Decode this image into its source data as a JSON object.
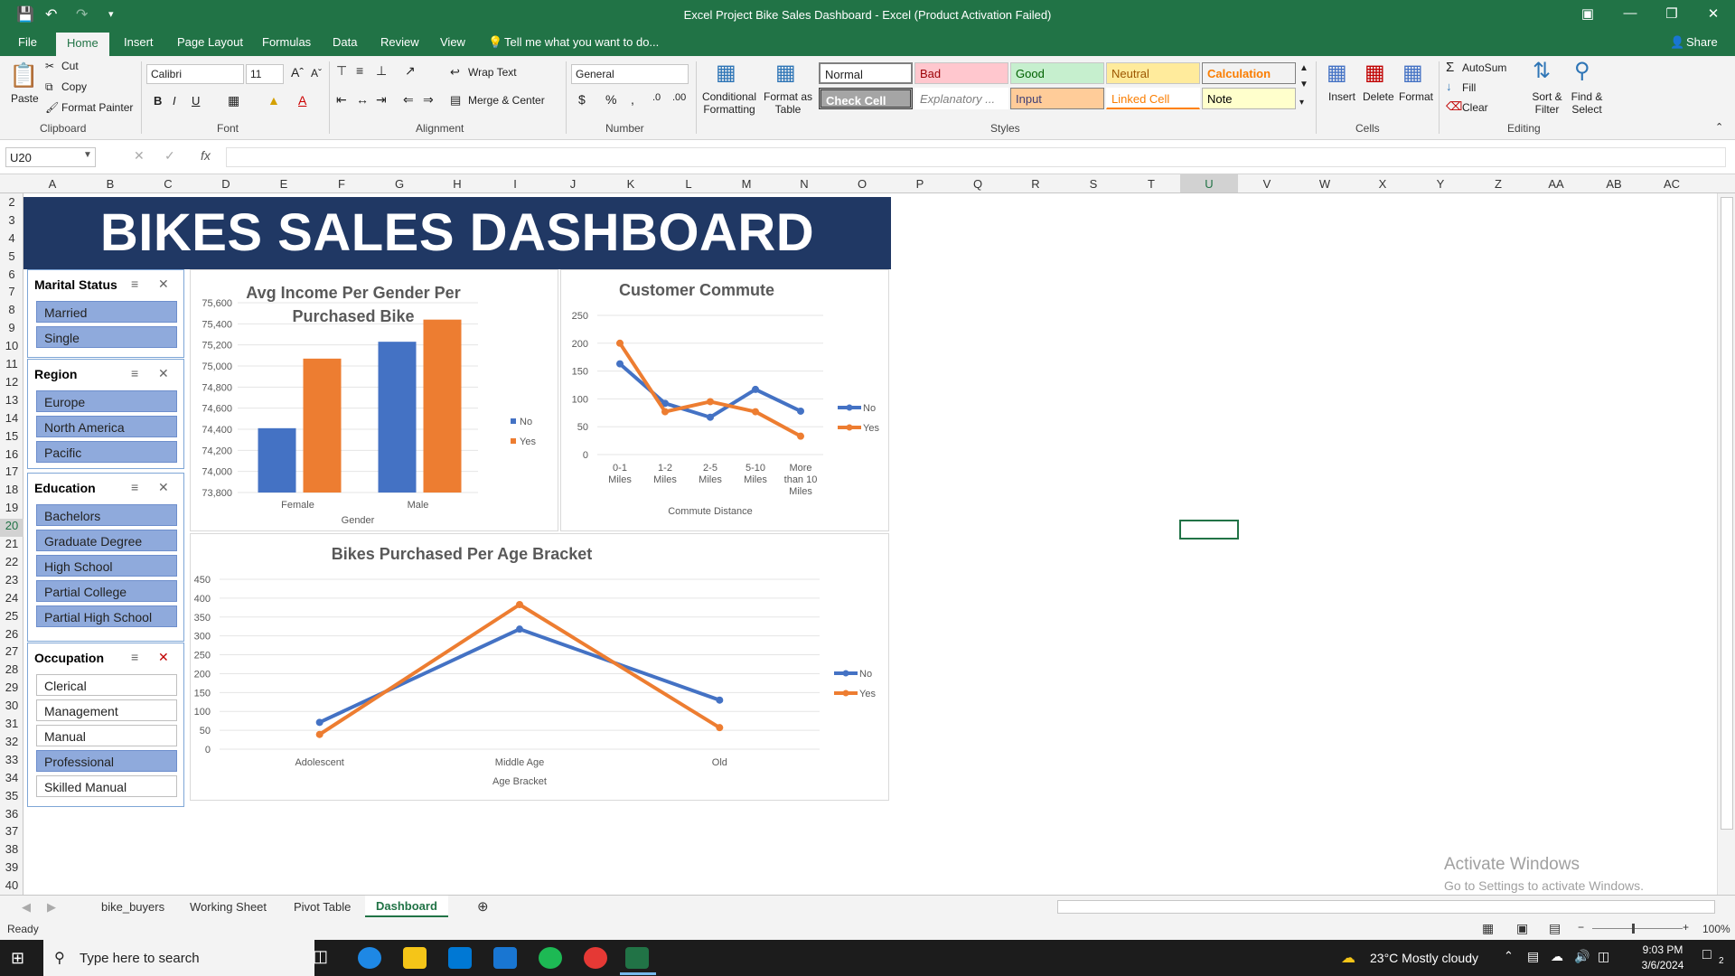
{
  "window": {
    "title": "Excel Project Bike Sales Dashboard - Excel (Product Activation Failed)",
    "share_label": "Share"
  },
  "tabs": [
    "File",
    "Home",
    "Insert",
    "Page Layout",
    "Formulas",
    "Data",
    "Review",
    "View"
  ],
  "tell_me": "Tell me what you want to do...",
  "ribbon": {
    "clipboard": {
      "paste": "Paste",
      "cut": "Cut",
      "copy": "Copy",
      "format_painter": "Format Painter",
      "label": "Clipboard"
    },
    "font": {
      "name": "Calibri",
      "size": "11",
      "label": "Font"
    },
    "alignment": {
      "wrap": "Wrap Text",
      "merge": "Merge & Center",
      "label": "Alignment"
    },
    "number": {
      "format": "General",
      "label": "Number"
    },
    "styles": {
      "conditional": "Conditional Formatting",
      "format_table": "Format as Table",
      "cells": [
        "Normal",
        "Bad",
        "Good",
        "Neutral",
        "Calculation",
        "Check Cell",
        "Explanatory ...",
        "Input",
        "Linked Cell",
        "Note"
      ],
      "label": "Styles"
    },
    "cells": {
      "insert": "Insert",
      "delete": "Delete",
      "format": "Format",
      "label": "Cells"
    },
    "editing": {
      "autosum": "AutoSum",
      "fill": "Fill",
      "clear": "Clear",
      "sort": "Sort & Filter",
      "find": "Find & Select",
      "label": "Editing"
    }
  },
  "name_box": "U20",
  "columns": [
    "A",
    "B",
    "C",
    "D",
    "E",
    "F",
    "G",
    "H",
    "I",
    "J",
    "K",
    "L",
    "M",
    "N",
    "O",
    "P",
    "Q",
    "R",
    "S",
    "T",
    "U",
    "V",
    "W",
    "X",
    "Y",
    "Z",
    "AA",
    "AB",
    "AC"
  ],
  "rows": [
    "2",
    "3",
    "4",
    "5",
    "6",
    "7",
    "8",
    "9",
    "10",
    "11",
    "12",
    "13",
    "14",
    "15",
    "16",
    "17",
    "18",
    "19",
    "20",
    "21",
    "22",
    "23",
    "24",
    "25",
    "26",
    "27",
    "28",
    "29",
    "30",
    "31",
    "32",
    "33",
    "34",
    "35",
    "36",
    "37",
    "38",
    "39",
    "40"
  ],
  "dashboard_title": "BIKES SALES DASHBOARD",
  "slicers": [
    {
      "title": "Marital Status",
      "items": [
        {
          "label": "Married",
          "selected": true
        },
        {
          "label": "Single",
          "selected": true
        }
      ]
    },
    {
      "title": "Region",
      "items": [
        {
          "label": "Europe",
          "selected": true
        },
        {
          "label": "North America",
          "selected": true
        },
        {
          "label": "Pacific",
          "selected": true
        }
      ]
    },
    {
      "title": "Education",
      "items": [
        {
          "label": "Bachelors",
          "selected": true
        },
        {
          "label": "Graduate Degree",
          "selected": true
        },
        {
          "label": "High School",
          "selected": true
        },
        {
          "label": "Partial College",
          "selected": true
        },
        {
          "label": "Partial High School",
          "selected": true
        }
      ]
    },
    {
      "title": "Occupation",
      "items": [
        {
          "label": "Clerical",
          "selected": false
        },
        {
          "label": "Management",
          "selected": false
        },
        {
          "label": "Manual",
          "selected": false
        },
        {
          "label": "Professional",
          "selected": true
        },
        {
          "label": "Skilled Manual",
          "selected": false
        }
      ]
    }
  ],
  "chart_data": [
    {
      "type": "bar",
      "title": "Avg Income Per Gender Per Purchased Bike",
      "xlabel": "Gender",
      "ylabel": "",
      "categories": [
        "Female",
        "Male"
      ],
      "series": [
        {
          "name": "No",
          "values": [
            74410,
            75230
          ],
          "color": "#4472c4"
        },
        {
          "name": "Yes",
          "values": [
            75070,
            75440
          ],
          "color": "#ed7d31"
        }
      ],
      "ylim": [
        73800,
        75600
      ],
      "yticks": [
        "75,600",
        "75,400",
        "75,200",
        "75,000",
        "74,800",
        "74,600",
        "74,400",
        "74,200",
        "74,000",
        "73,800"
      ],
      "legend": "right"
    },
    {
      "type": "line",
      "title": "Customer Commute",
      "xlabel": "Commute Distance",
      "ylabel": "",
      "categories": [
        "0-1 Miles",
        "1-2 Miles",
        "2-5 Miles",
        "5-10 Miles",
        "More than 10 Miles"
      ],
      "series": [
        {
          "name": "No",
          "values": [
            163,
            92,
            67,
            117,
            78
          ],
          "color": "#4472c4"
        },
        {
          "name": "Yes",
          "values": [
            200,
            77,
            95,
            77,
            33
          ],
          "color": "#ed7d31"
        }
      ],
      "ylim": [
        0,
        250
      ],
      "yticks": [
        "250",
        "200",
        "150",
        "100",
        "50",
        "0"
      ],
      "legend": "right"
    },
    {
      "type": "line",
      "title": "Bikes Purchased Per Age Bracket",
      "xlabel": "Age Bracket",
      "ylabel": "",
      "categories": [
        "Adolescent",
        "Middle Age",
        "Old"
      ],
      "series": [
        {
          "name": "No",
          "values": [
            71,
            318,
            130
          ],
          "color": "#4472c4"
        },
        {
          "name": "Yes",
          "values": [
            39,
            383,
            57
          ],
          "color": "#ed7d31"
        }
      ],
      "ylim": [
        0,
        450
      ],
      "yticks": [
        "450",
        "400",
        "350",
        "300",
        "250",
        "200",
        "150",
        "100",
        "50",
        "0"
      ],
      "legend": "right"
    }
  ],
  "sheets": [
    "bike_buyers",
    "Working Sheet",
    "Pivot Table",
    "Dashboard"
  ],
  "active_sheet": "Dashboard",
  "status": {
    "ready": "Ready",
    "zoom": "100%"
  },
  "watermark": {
    "line1": "Activate Windows",
    "line2": "Go to Settings to activate Windows."
  },
  "taskbar": {
    "search_placeholder": "Type here to search",
    "weather": "23°C  Mostly cloudy",
    "time": "9:03 PM",
    "date": "3/6/2024",
    "notifications": "2"
  }
}
